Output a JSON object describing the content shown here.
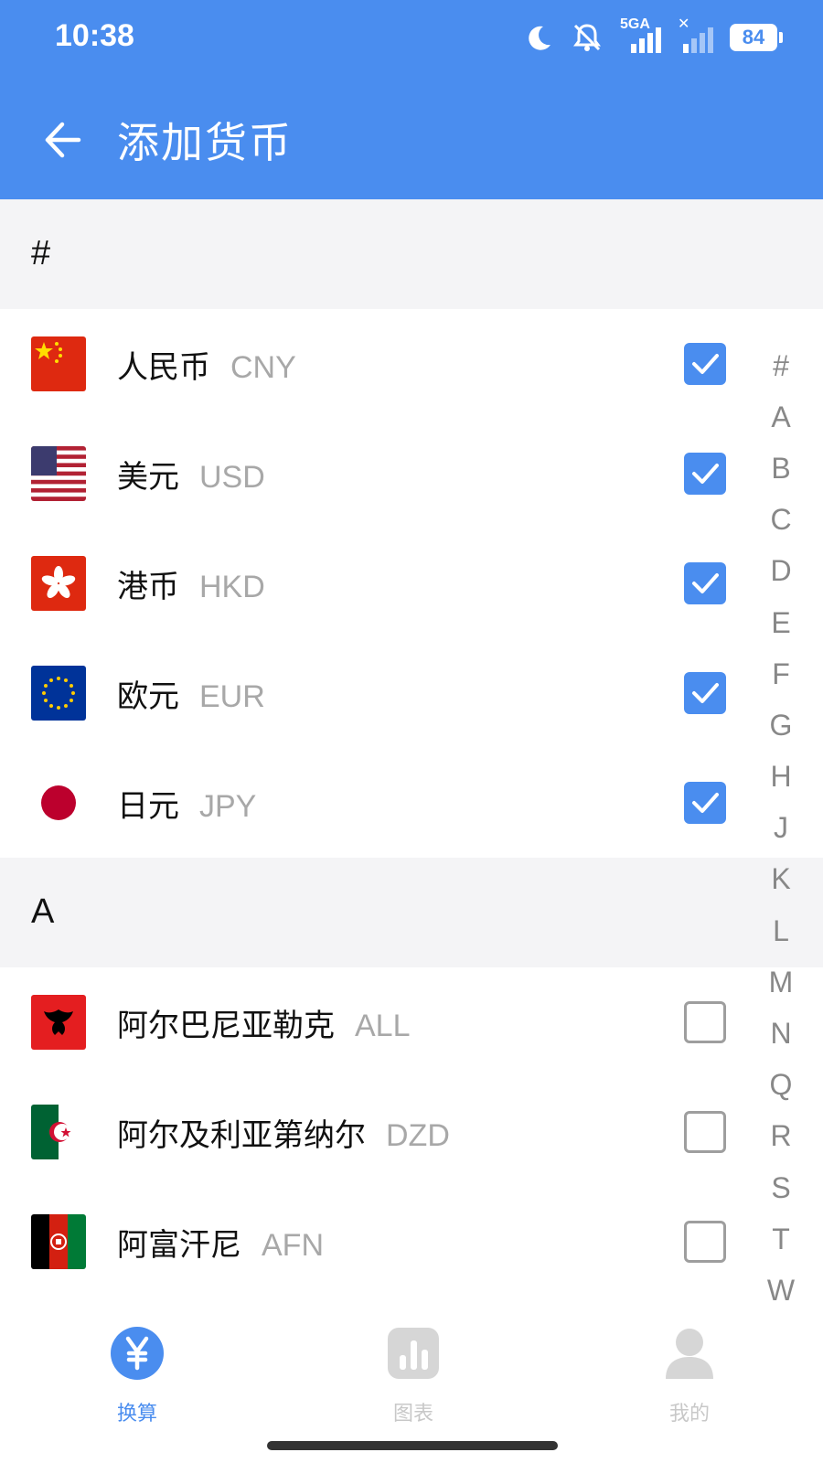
{
  "status_bar": {
    "time": "10:38",
    "network": "5GA",
    "battery": "84"
  },
  "header": {
    "title": "添加货币"
  },
  "sections": [
    {
      "label": "#"
    },
    {
      "label": "A"
    }
  ],
  "currencies": [
    {
      "name": "人民币",
      "code": "CNY",
      "checked": true
    },
    {
      "name": "美元",
      "code": "USD",
      "checked": true
    },
    {
      "name": "港币",
      "code": "HKD",
      "checked": true
    },
    {
      "name": "欧元",
      "code": "EUR",
      "checked": true
    },
    {
      "name": "日元",
      "code": "JPY",
      "checked": true
    },
    {
      "name": "阿尔巴尼亚勒克",
      "code": "ALL",
      "checked": false
    },
    {
      "name": "阿尔及利亚第纳尔",
      "code": "DZD",
      "checked": false
    },
    {
      "name": "阿富汗尼",
      "code": "AFN",
      "checked": false
    }
  ],
  "index_letters": [
    "#",
    "A",
    "B",
    "C",
    "D",
    "E",
    "F",
    "G",
    "H",
    "J",
    "K",
    "L",
    "M",
    "N",
    "Q",
    "R",
    "S",
    "T",
    "W"
  ],
  "bottom_nav": [
    {
      "label": "换算",
      "active": true
    },
    {
      "label": "图表",
      "active": false
    },
    {
      "label": "我的",
      "active": false
    }
  ],
  "colors": {
    "accent": "#4A8DEF",
    "section_bg": "#F4F4F6",
    "code_text": "#A8A8A8",
    "inactive_nav": "#C8C8C8"
  }
}
